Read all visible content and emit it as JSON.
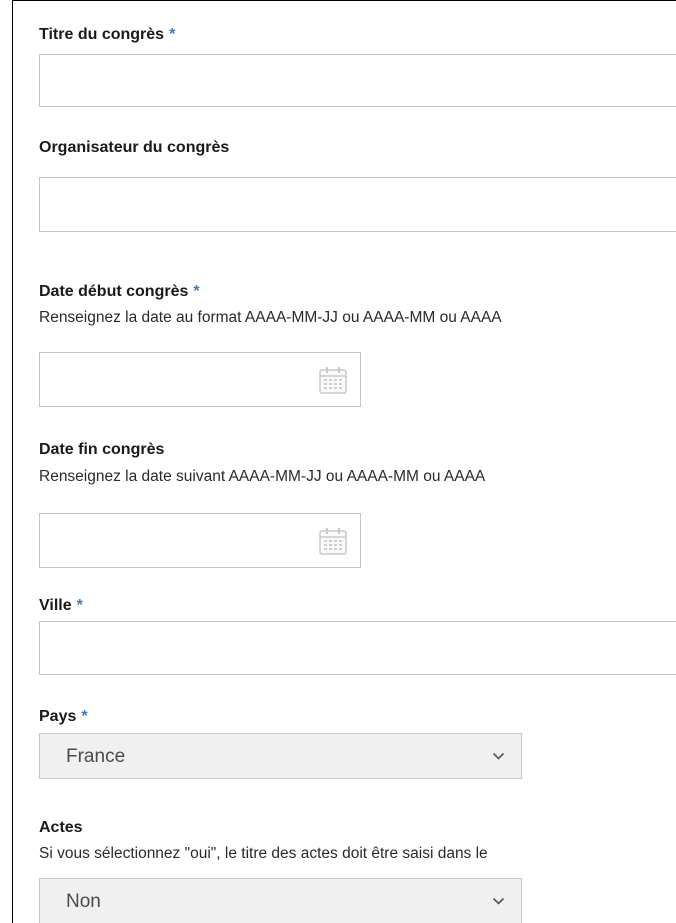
{
  "form": {
    "required_mark": "*",
    "title_field": {
      "label": "Titre du congrès",
      "value": ""
    },
    "organizer_field": {
      "label": "Organisateur du congrès",
      "value": ""
    },
    "start_date_field": {
      "label": "Date début congrès",
      "hint": "Renseignez la date au format AAAA-MM-JJ ou AAAA-MM ou AAAA",
      "value": "",
      "icon": "calendar-icon"
    },
    "end_date_field": {
      "label": "Date fin congrès",
      "hint": "Renseignez la date suivant AAAA-MM-JJ ou AAAA-MM ou AAAA",
      "value": "",
      "icon": "calendar-icon"
    },
    "city_field": {
      "label": "Ville",
      "value": ""
    },
    "country_field": {
      "label": "Pays",
      "selected": "France",
      "icon": "chevron-down-icon"
    },
    "acts_field": {
      "label": "Actes",
      "hint": "Si vous sélectionnez \"oui\", le titre des actes doit être saisi dans le",
      "selected": "Non",
      "icon": "chevron-down-icon"
    }
  },
  "colors": {
    "required_accent": "#3d7ab8",
    "input_border": "#c4c4c4",
    "select_background": "#f0f0f0"
  }
}
